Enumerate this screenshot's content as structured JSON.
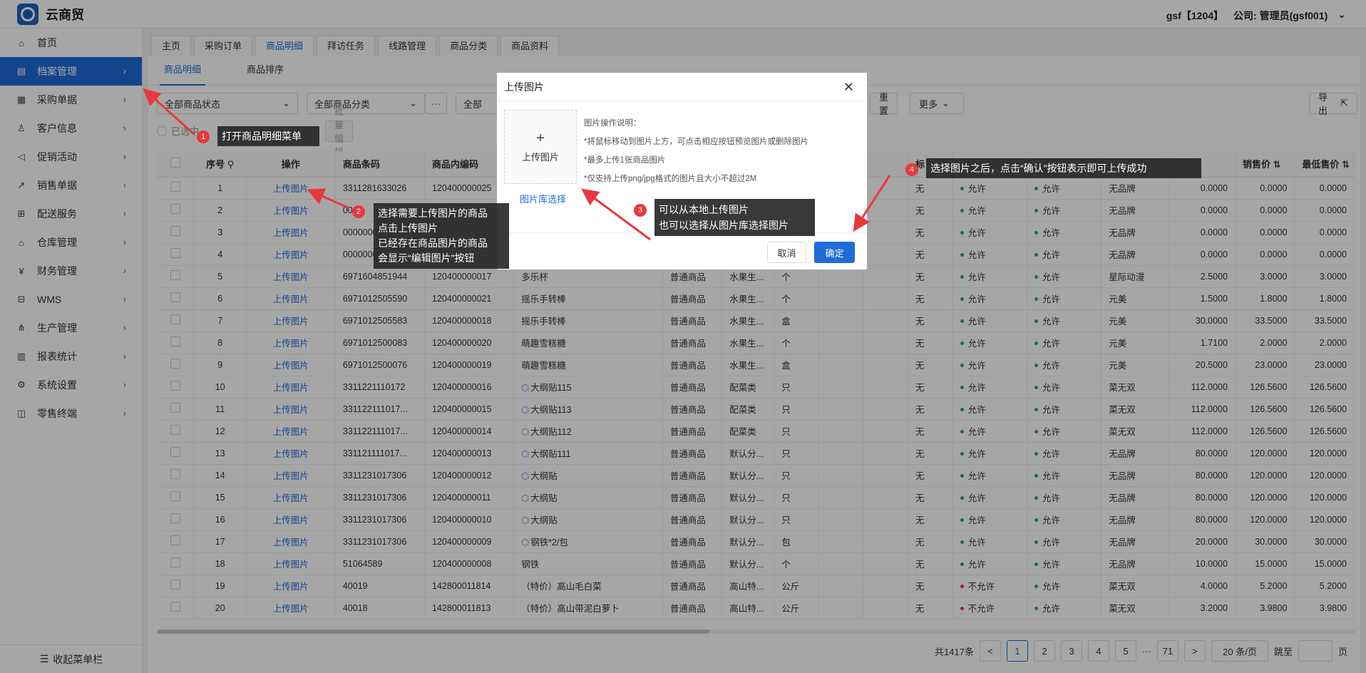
{
  "app": {
    "name": "云商贸",
    "user": "gsf【1204】",
    "company": "公司: 管理员(gsf001)"
  },
  "sidebar": {
    "items": [
      {
        "label": "首页",
        "icon": "home-icon",
        "glyph": "⌂"
      },
      {
        "label": "档案管理",
        "icon": "archive-icon",
        "glyph": "▤"
      },
      {
        "label": "采购单据",
        "icon": "purchase-icon",
        "glyph": "▦"
      },
      {
        "label": "客户信息",
        "icon": "user-icon",
        "glyph": "♙"
      },
      {
        "label": "促销活动",
        "icon": "megaphone-icon",
        "glyph": "◁"
      },
      {
        "label": "销售单据",
        "icon": "chart-icon",
        "glyph": "↗"
      },
      {
        "label": "配送服务",
        "icon": "cart-icon",
        "glyph": "⊞"
      },
      {
        "label": "仓库管理",
        "icon": "warehouse-icon",
        "glyph": "⌂"
      },
      {
        "label": "财务管理",
        "icon": "finance-icon",
        "glyph": "¥"
      },
      {
        "label": "WMS",
        "icon": "truck-icon",
        "glyph": "⊟"
      },
      {
        "label": "生产管理",
        "icon": "production-icon",
        "glyph": "⋔"
      },
      {
        "label": "报表统计",
        "icon": "report-icon",
        "glyph": "▥"
      },
      {
        "label": "系统设置",
        "icon": "gear-icon",
        "glyph": "⚙"
      },
      {
        "label": "零售终端",
        "icon": "bag-icon",
        "glyph": "◫"
      }
    ],
    "collapse": "收起菜单栏"
  },
  "tabs": [
    "主页",
    "采购订单",
    "商品明细",
    "拜访任务",
    "线路管理",
    "商品分类",
    "商品资料"
  ],
  "subtabs": [
    "商品明细",
    "商品排序"
  ],
  "filters": {
    "status": "全部商品状态",
    "category": "全部商品分类",
    "more_dots": "···",
    "all": "全部",
    "reset": "重置",
    "more": "更多",
    "export": "导出",
    "selected": "已选中",
    "batch": "批量编辑"
  },
  "table": {
    "headers": [
      "序号",
      "操作",
      "商品条码",
      "商品内编码",
      "",
      "",
      "",
      "",
      "",
      "",
      "标",
      "",
      "",
      "",
      "销售价",
      "最低售价"
    ],
    "rows": [
      {
        "n": "1",
        "op": "上传图片",
        "code": "3311281633026",
        "inner": "120400000025",
        "name": "",
        "type": "",
        "cls": "",
        "unit": "",
        "tag": "无",
        "ap1": "允许",
        "ap1c": "#2fa84f",
        "ap2": "允许",
        "brand": "无品牌",
        "p1": "0.0000",
        "p2": "0.0000",
        "cube": false
      },
      {
        "n": "2",
        "op": "上传图片",
        "code": "000",
        "inner": "",
        "name": "",
        "type": "",
        "cls": "",
        "unit": "",
        "tag": "无",
        "ap1": "允许",
        "ap1c": "#2fa84f",
        "ap2": "允许",
        "brand": "无品牌",
        "p1": "0.0000",
        "p2": "0.0000",
        "cube": false
      },
      {
        "n": "3",
        "op": "上传图片",
        "code": "0000000",
        "inner": "",
        "name": "",
        "type": "",
        "cls": "",
        "unit": "",
        "tag": "无",
        "ap1": "允许",
        "ap1c": "#2fa84f",
        "ap2": "允许",
        "brand": "无品牌",
        "p1": "0.0000",
        "p2": "0.0000",
        "cube": false
      },
      {
        "n": "4",
        "op": "上传图片",
        "code": "0000000",
        "inner": "",
        "name": "",
        "type": "",
        "cls": "",
        "unit": "",
        "tag": "无",
        "ap1": "允许",
        "ap1c": "#2fa84f",
        "ap2": "允许",
        "brand": "无品牌",
        "p1": "0.0000",
        "p2": "0.0000",
        "cube": false
      },
      {
        "n": "5",
        "op": "上传图片",
        "code": "6971604851944",
        "inner": "120400000017",
        "name": "多乐杯",
        "type": "普通商品",
        "cls": "水果生...",
        "unit": "个",
        "tag": "无",
        "ap1": "允许",
        "ap1c": "#2fa84f",
        "ap2": "允许",
        "brand": "星际动漫",
        "p1": "2.5000",
        "p2": "3.0000",
        "cube": false
      },
      {
        "n": "6",
        "op": "上传图片",
        "code": "6971012505590",
        "inner": "120400000021",
        "name": "摇乐手转棒",
        "type": "普通商品",
        "cls": "水果生...",
        "unit": "个",
        "tag": "无",
        "ap1": "允许",
        "ap1c": "#2fa84f",
        "ap2": "允许",
        "brand": "元美",
        "p1": "1.5000",
        "p2": "1.8000",
        "cube": false
      },
      {
        "n": "7",
        "op": "上传图片",
        "code": "6971012505583",
        "inner": "120400000018",
        "name": "摇乐手转棒",
        "type": "普通商品",
        "cls": "水果生...",
        "unit": "盒",
        "tag": "无",
        "ap1": "允许",
        "ap1c": "#2fa84f",
        "ap2": "允许",
        "brand": "元美",
        "p1": "30.0000",
        "p2": "33.5000",
        "cube": false
      },
      {
        "n": "8",
        "op": "上传图片",
        "code": "6971012500083",
        "inner": "120400000020",
        "name": "萌趣雪糕糖",
        "type": "普通商品",
        "cls": "水果生...",
        "unit": "个",
        "tag": "无",
        "ap1": "允许",
        "ap1c": "#2fa84f",
        "ap2": "允许",
        "brand": "元美",
        "p1": "1.7100",
        "p2": "2.0000",
        "cube": false
      },
      {
        "n": "9",
        "op": "上传图片",
        "code": "6971012500076",
        "inner": "120400000019",
        "name": "萌趣雪糕糖",
        "type": "普通商品",
        "cls": "水果生...",
        "unit": "盒",
        "tag": "无",
        "ap1": "允许",
        "ap1c": "#2fa84f",
        "ap2": "允许",
        "brand": "元美",
        "p1": "20.5000",
        "p2": "23.0000",
        "cube": false
      },
      {
        "n": "10",
        "op": "上传图片",
        "code": "3311221110172",
        "inner": "120400000016",
        "name": "大纲贴115",
        "type": "普通商品",
        "cls": "配菜类",
        "unit": "只",
        "tag": "无",
        "ap1": "允许",
        "ap1c": "#2fa84f",
        "ap2": "允许",
        "brand": "菜无双",
        "p1": "112.0000",
        "p2": "126.5600",
        "cube": true
      },
      {
        "n": "11",
        "op": "上传图片",
        "code": "331122111017...",
        "inner": "120400000015",
        "name": "大纲贴113",
        "type": "普通商品",
        "cls": "配菜类",
        "unit": "只",
        "tag": "无",
        "ap1": "允许",
        "ap1c": "#2fa84f",
        "ap2": "允许",
        "brand": "菜无双",
        "p1": "112.0000",
        "p2": "126.5600",
        "cube": true
      },
      {
        "n": "12",
        "op": "上传图片",
        "code": "331122111017...",
        "inner": "120400000014",
        "name": "大纲贴112",
        "type": "普通商品",
        "cls": "配菜类",
        "unit": "只",
        "tag": "无",
        "ap1": "允许",
        "ap1c": "#2fa84f",
        "ap2": "允许",
        "brand": "菜无双",
        "p1": "112.0000",
        "p2": "126.5600",
        "cube": true
      },
      {
        "n": "13",
        "op": "上传图片",
        "code": "331121111017...",
        "inner": "120400000013",
        "name": "大纲贴111",
        "type": "普通商品",
        "cls": "默认分...",
        "unit": "只",
        "tag": "无",
        "ap1": "允许",
        "ap1c": "#2fa84f",
        "ap2": "允许",
        "brand": "无品牌",
        "p1": "80.0000",
        "p2": "120.0000",
        "cube": true
      },
      {
        "n": "14",
        "op": "上传图片",
        "code": "3311231017306",
        "inner": "120400000012",
        "name": "大纲贴",
        "type": "普通商品",
        "cls": "默认分...",
        "unit": "只",
        "tag": "无",
        "ap1": "允许",
        "ap1c": "#2fa84f",
        "ap2": "允许",
        "brand": "无品牌",
        "p1": "80.0000",
        "p2": "120.0000",
        "cube": true
      },
      {
        "n": "15",
        "op": "上传图片",
        "code": "3311231017306",
        "inner": "120400000011",
        "name": "大纲贴",
        "type": "普通商品",
        "cls": "默认分...",
        "unit": "只",
        "tag": "无",
        "ap1": "允许",
        "ap1c": "#2fa84f",
        "ap2": "允许",
        "brand": "无品牌",
        "p1": "80.0000",
        "p2": "120.0000",
        "cube": true
      },
      {
        "n": "16",
        "op": "上传图片",
        "code": "3311231017306",
        "inner": "120400000010",
        "name": "大纲贴",
        "type": "普通商品",
        "cls": "默认分...",
        "unit": "只",
        "tag": "无",
        "ap1": "允许",
        "ap1c": "#2fa84f",
        "ap2": "允许",
        "brand": "无品牌",
        "p1": "80.0000",
        "p2": "120.0000",
        "cube": true
      },
      {
        "n": "17",
        "op": "上传图片",
        "code": "3311231017306",
        "inner": "120400000009",
        "name": "钢铁*2/包",
        "type": "普通商品",
        "cls": "默认分...",
        "unit": "包",
        "tag": "无",
        "ap1": "允许",
        "ap1c": "#2fa84f",
        "ap2": "允许",
        "brand": "无品牌",
        "p1": "20.0000",
        "p2": "30.0000",
        "cube": true
      },
      {
        "n": "18",
        "op": "上传图片",
        "code": "51064589",
        "inner": "120400000008",
        "name": "钢铁",
        "type": "普通商品",
        "cls": "默认分...",
        "unit": "个",
        "tag": "无",
        "ap1": "允许",
        "ap1c": "#2fa84f",
        "ap2": "允许",
        "brand": "无品牌",
        "p1": "10.0000",
        "p2": "15.0000",
        "cube": false
      },
      {
        "n": "19",
        "op": "上传图片",
        "code": "40019",
        "inner": "142800011814",
        "name": "（特价）高山毛白菜",
        "type": "普通商品",
        "cls": "高山特...",
        "unit": "公斤",
        "tag": "无",
        "ap1": "不允许",
        "ap1c": "#e8383d",
        "ap2": "允许",
        "brand": "菜无双",
        "p1": "4.0000",
        "p2": "5.2000",
        "cube": false
      },
      {
        "n": "20",
        "op": "上传图片",
        "code": "40018",
        "inner": "142800011813",
        "name": "（特价）高山带泥白萝卜",
        "type": "普通商品",
        "cls": "高山特...",
        "unit": "公斤",
        "tag": "无",
        "ap1": "不允许",
        "ap1c": "#e8383d",
        "ap2": "允许",
        "brand": "菜无双",
        "p1": "3.2000",
        "p2": "3.9800",
        "cube": false
      }
    ]
  },
  "pager": {
    "total": "共1417条",
    "prev": "<",
    "pages": [
      "1",
      "2",
      "3",
      "4",
      "5"
    ],
    "ellipsis": "···",
    "last": "71",
    "next": ">",
    "size": "20 条/页",
    "jump": "跳至",
    "unit": "页"
  },
  "modal": {
    "title": "上传图片",
    "close": "✕",
    "upload": "上传图片",
    "library": "图片库选择",
    "notes": [
      "图片操作说明：",
      "*将鼠标移动到图片上方，可点击相应按钮预览图片或删除图片",
      "*最多上传1张商品图片",
      "*仅支持上传png/jpg格式的图片且大小不超过2M"
    ],
    "cancel": "取消",
    "ok": "确定"
  },
  "annotations": [
    {
      "num": "1",
      "text": "打开商品明细菜单"
    },
    {
      "num": "2",
      "text": "选择需要上传图片的商品\n点击上传图片\n已经存在商品图片的商品\n会显示“编辑图片”按钮"
    },
    {
      "num": "3",
      "text": "可以从本地上传图片\n也可以选择从图片库选择图片"
    },
    {
      "num": "4",
      "text": "选择图片之后，点击“确认”按钮表示即可上传成功"
    }
  ],
  "colors": {
    "primary": "#1f6bd8",
    "annotation": "#e8383d"
  }
}
